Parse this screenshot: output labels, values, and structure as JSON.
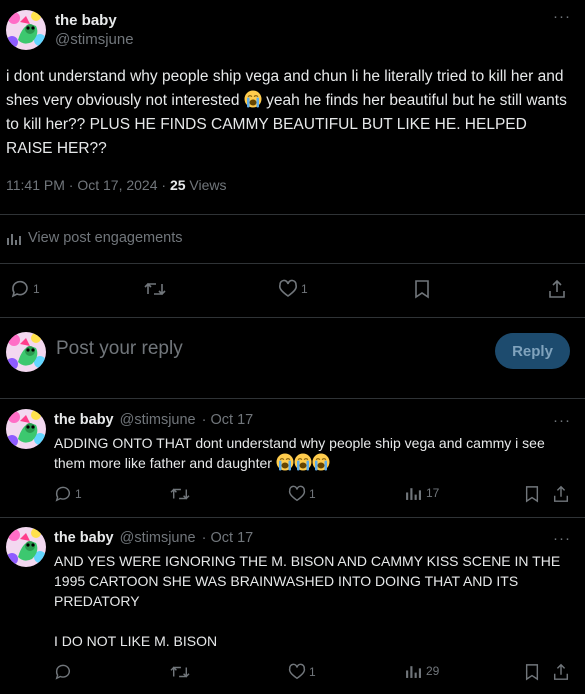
{
  "main_post": {
    "author": {
      "display_name": "the baby",
      "handle": "@stimsjune"
    },
    "more_label": "···",
    "text_parts": [
      "i dont understand why people ship vega and chun li he literally tried to kill her and shes very obviously not interested ",
      " yeah he finds her beautiful but he still wants to kill her?? PLUS HE FINDS CAMMY BEAUTIFUL BUT LIKE HE. HELPED RAISE HER??"
    ],
    "emoji_icon": "loudly-crying-face-emoji",
    "timestamp": "11:41 PM · Oct 17, 2024 · ",
    "views_count": "25",
    "views_label": " Views",
    "engagements_label": "View post engagements",
    "actions": {
      "reply_count": "1",
      "repost_count": "",
      "like_count": "1"
    }
  },
  "reply_composer": {
    "placeholder": "Post your reply",
    "button_label": "Reply"
  },
  "replies": [
    {
      "display_name": "the baby",
      "handle": "@stimsjune",
      "date": " · Oct 17",
      "text": "ADDING ONTO THAT dont understand why people ship vega and cammy i see them more like father and daughter ",
      "emoji_count": 3,
      "reply_count": "1",
      "like_count": "1",
      "views_count": "17"
    },
    {
      "display_name": "the baby",
      "handle": "@stimsjune",
      "date": " · Oct 17",
      "text_line1": "AND YES WERE IGNORING THE M. BISON AND CAMMY KISS SCENE IN THE 1995 CARTOON SHE WAS BRAINWASHED INTO DOING THAT AND ITS PREDATORY",
      "text_line2": "I DO NOT LIKE M. BISON",
      "reply_count": "",
      "like_count": "1",
      "views_count": "29"
    }
  ],
  "colors": {
    "background": "#000000",
    "text": "#e7e9ea",
    "muted": "#71767b",
    "divider": "#2f3336",
    "reply_button_bg": "#1d4b6e"
  }
}
